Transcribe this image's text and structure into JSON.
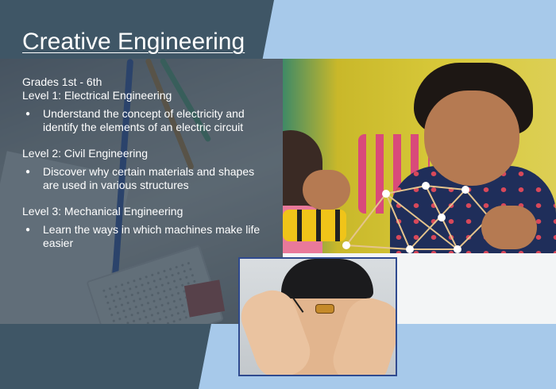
{
  "title": "Creative Engineering",
  "grades": "Grades 1st - 6th",
  "levels": [
    {
      "heading": "Level 1: Electrical Engineering",
      "bullet": "Understand the concept of electricity and identify the elements of an electric circuit"
    },
    {
      "heading": "Level 2: Civil Engineering",
      "bullet": "Discover why certain materials and shapes are used in various structures"
    },
    {
      "heading": "Level 3: Mechanical Engineering",
      "bullet": "Learn the ways in which machines make life easier"
    }
  ],
  "colors": {
    "background": "#a7c9ea",
    "band": "#3f5666",
    "text": "#ffffff"
  }
}
